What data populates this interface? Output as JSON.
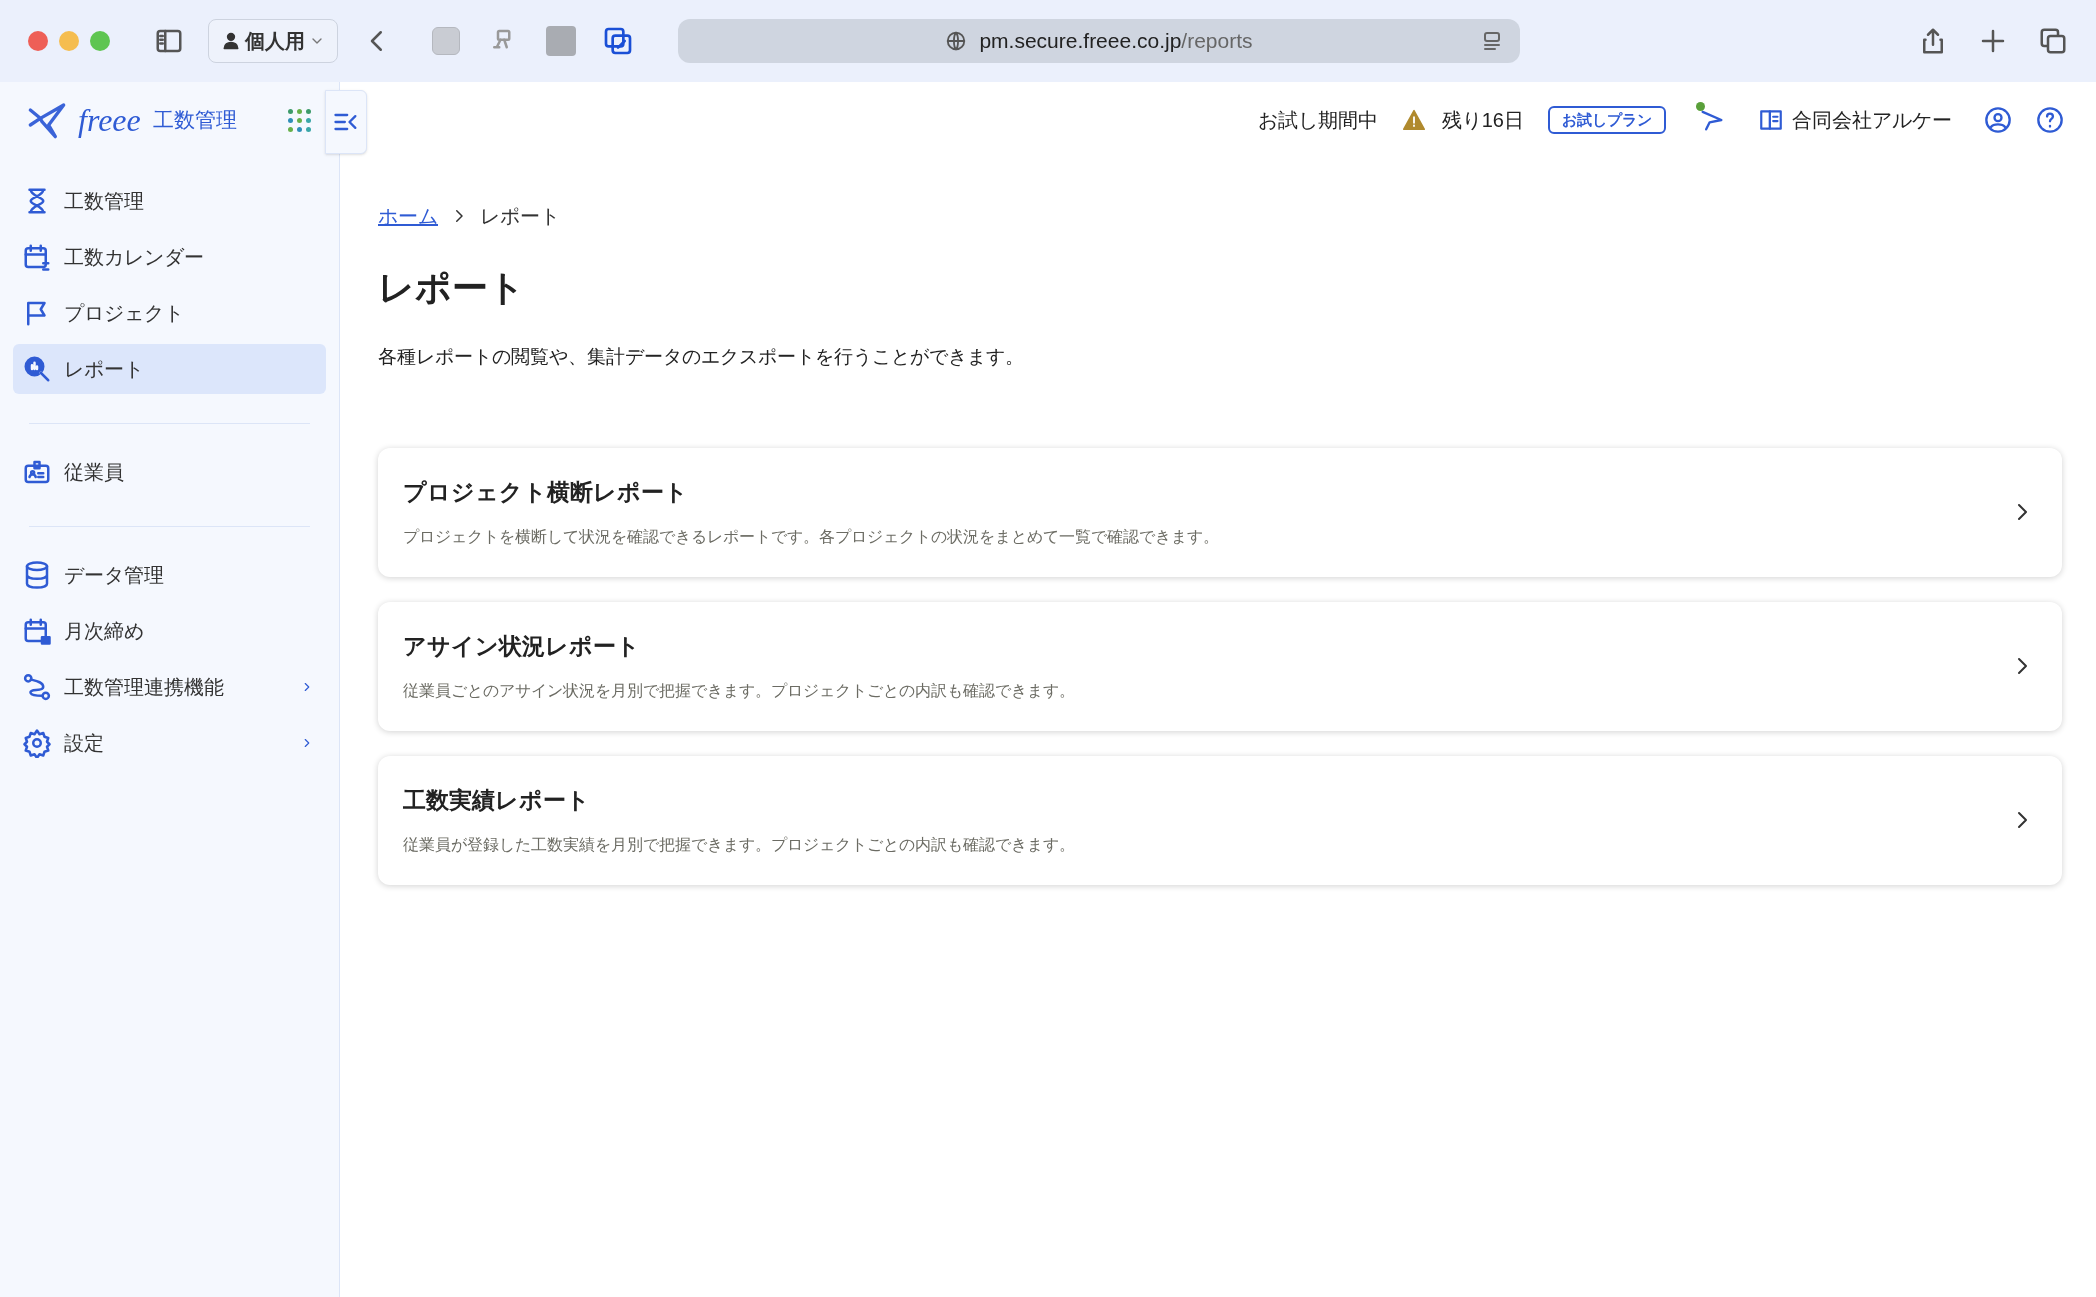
{
  "browser": {
    "profile": "個人用",
    "url_host": "pm.secure.freee.co.jp",
    "url_path": "/reports"
  },
  "logo": {
    "brand": "freee",
    "product": "工数管理"
  },
  "sidebar": {
    "sections": [
      [
        {
          "label": "工数管理",
          "selected": false,
          "has_submenu": false
        },
        {
          "label": "工数カレンダー",
          "selected": false,
          "has_submenu": false
        },
        {
          "label": "プロジェクト",
          "selected": false,
          "has_submenu": false
        },
        {
          "label": "レポート",
          "selected": true,
          "has_submenu": false
        }
      ],
      [
        {
          "label": "従業員",
          "selected": false,
          "has_submenu": false
        }
      ],
      [
        {
          "label": "データ管理",
          "selected": false,
          "has_submenu": false
        },
        {
          "label": "月次締め",
          "selected": false,
          "has_submenu": false
        },
        {
          "label": "工数管理連携機能",
          "selected": false,
          "has_submenu": true
        },
        {
          "label": "設定",
          "selected": false,
          "has_submenu": true
        }
      ]
    ]
  },
  "header": {
    "trial_status": "お試し期間中",
    "remaining": "残り16日",
    "plan_badge": "お試しプラン",
    "announcements_unread": true,
    "company": "合同会社アルケー"
  },
  "breadcrumb": [
    {
      "label": "ホーム",
      "link": true
    },
    {
      "label": "レポート",
      "link": false
    }
  ],
  "title": "レポート",
  "description": "各種レポートの閲覧や、集計データのエクスポートを行うことができます。",
  "cards": [
    {
      "title": "プロジェクト横断レポート",
      "description": "プロジェクトを横断して状況を確認できるレポートです。各プロジェクトの状況をまとめて一覧で確認できます。"
    },
    {
      "title": "アサイン状況レポート",
      "description": "従業員ごとのアサイン状況を月別で把握できます。プロジェクトごとの内訳も確認できます。"
    },
    {
      "title": "工数実績レポート",
      "description": "従業員が登録した工数実績を月別で把握できます。プロジェクトごとの内訳も確認できます。"
    }
  ]
}
